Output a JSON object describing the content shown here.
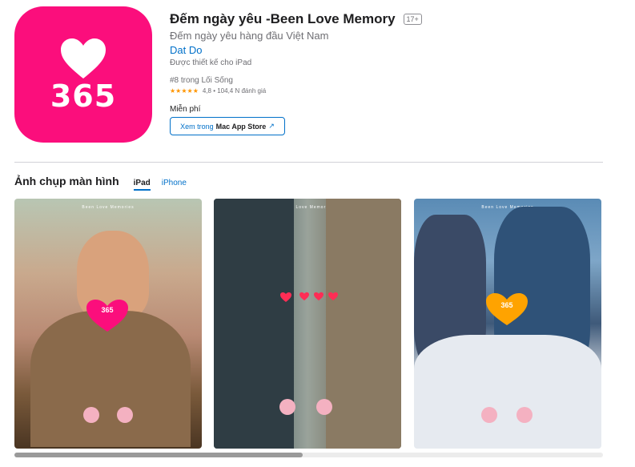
{
  "app": {
    "title": "Đếm ngày yêu -Been Love Memory",
    "age_rating": "17+",
    "subtitle": "Đếm ngày yêu hàng đầu Việt Nam",
    "developer": "Dat Do",
    "designed_for": "Được thiết kế cho iPad",
    "rank": "#8 trong Lối Sống",
    "stars": "★★★★★",
    "rating": "4,8 • 104,4 N đánh giá",
    "price": "Miễn phí",
    "icon_number": "365",
    "icon_color": "#fb0e7c"
  },
  "store_button": {
    "prefix": "Xem trong",
    "bold": "Mac App Store",
    "arrow": "↗"
  },
  "screenshots": {
    "title": "Ảnh chụp màn hình",
    "tabs": [
      "iPad",
      "iPhone"
    ],
    "active_tab": "iPad",
    "items": [
      {
        "app_name": "Been Love Memories",
        "counter": "365"
      },
      {
        "app_name": "Been Love Memories",
        "counter": ""
      },
      {
        "app_name": "Been Love Memories",
        "counter": "365"
      }
    ]
  },
  "colors": {
    "link": "#0070c9",
    "star": "#ff9500"
  }
}
